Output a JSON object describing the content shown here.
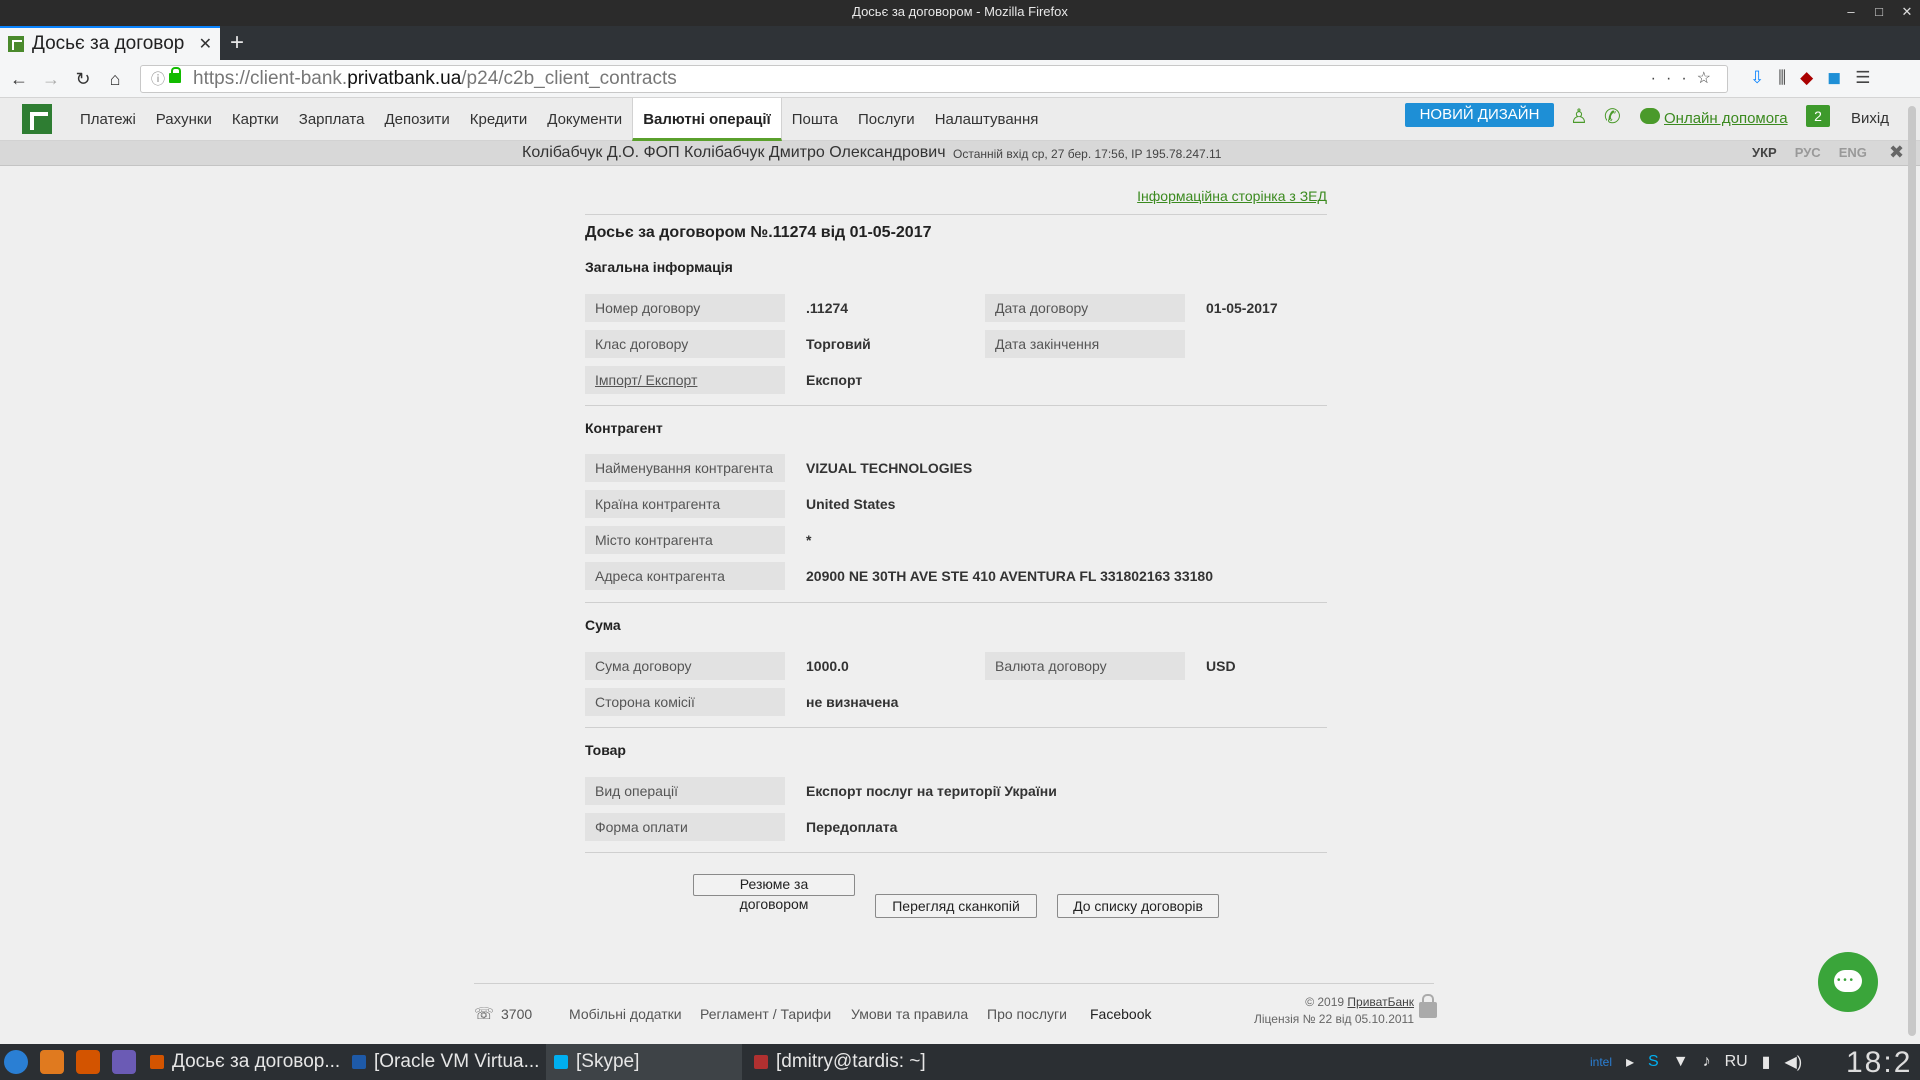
{
  "window": {
    "title": "Досьє за договором - Mozilla Firefox"
  },
  "browser": {
    "tab_title": "Досьє за договор",
    "url_prefix": "https://client-bank.",
    "url_host": "privatbank.ua",
    "url_path": "/p24/c2b_client_contracts"
  },
  "nav": {
    "items": [
      "Платежі",
      "Рахунки",
      "Картки",
      "Зарплата",
      "Депозити",
      "Кредити",
      "Документи",
      "Валютні операції",
      "Пошта",
      "Послуги",
      "Налаштування"
    ],
    "active_index": 7,
    "new_design": "НОВИЙ ДИЗАЙН",
    "help": "Онлайн допомога",
    "messages_count": "2",
    "logout": "Вихід"
  },
  "userbar": {
    "name": "Колібабчук Д.О. ФОП Колібабчук Дмитро Олександрович",
    "last_login": "Останній вхід ср, 27 бер. 17:56, IP 195.78.247.11",
    "langs": [
      "УКР",
      "РУС",
      "ENG"
    ]
  },
  "page": {
    "zed_link": "Інформаційна сторінка з ЗЕД",
    "title": "Досьє за договором №.11274 від 01-05-2017",
    "general": {
      "heading": "Загальна інформація",
      "contract_no_label": "Номер договору",
      "contract_no": ".11274",
      "contract_date_label": "Дата договору",
      "contract_date": "01-05-2017",
      "class_label": "Клас договору",
      "class_value": "Торговий",
      "end_date_label": "Дата закінчення",
      "end_date": "",
      "impexp_label": "Імпорт/ Експорт",
      "impexp_value": "Експорт"
    },
    "counterparty": {
      "heading": "Контрагент",
      "name_label": "Найменування контрагента",
      "name": "VIZUAL TECHNOLOGIES",
      "country_label": "Країна контрагента",
      "country": "United States",
      "city_label": "Місто контрагента",
      "city": "*",
      "address_label": "Адреса контрагента",
      "address": "20900 NE 30TH AVE STE 410 AVENTURA FL 331802163 33180"
    },
    "sum": {
      "heading": "Сума",
      "amount_label": "Сума договору",
      "amount": "1000.0",
      "currency_label": "Валюта договору",
      "currency": "USD",
      "commission_label": "Сторона комісії",
      "commission": "не визначена"
    },
    "goods": {
      "heading": "Товар",
      "operation_label": "Вид операції",
      "operation": "Експорт послуг на території України",
      "payment_label": "Форма оплати",
      "payment": "Передоплата"
    },
    "buttons": {
      "summary_line1": "Резюме за",
      "summary_line2": "договором",
      "scans": "Перегляд сканкопій",
      "back": "До списку договорів"
    }
  },
  "footer": {
    "phone": "3700",
    "links": [
      "Мобільні додатки",
      "Регламент / Тарифи",
      "Умови та правила",
      "Про послуги",
      "Facebook"
    ],
    "copyright_prefix": "© 2019 ",
    "copyright_brand": "ПриватБанк",
    "license": "Ліцензія № 22 від 05.10.2011"
  },
  "taskbar": {
    "items": [
      "Досьє за договор...",
      "[Oracle VM Virtua...",
      "[Skype]",
      "[dmitry@tardis: ~]"
    ],
    "lang": "RU",
    "clock": "18:2"
  },
  "colors": {
    "accent_green": "#3b8a1f",
    "new_design_blue": "#1e8fd6",
    "firefox_blue": "#0a84ff"
  }
}
